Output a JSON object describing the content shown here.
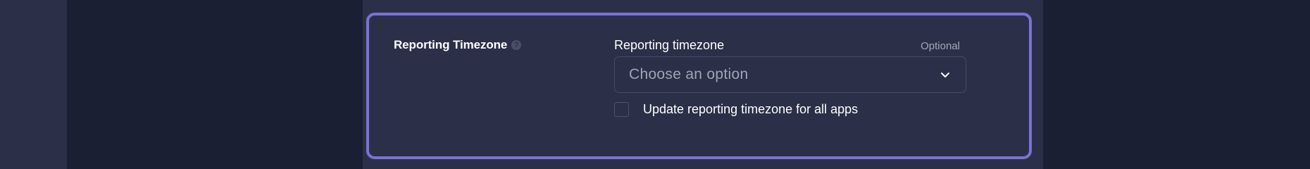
{
  "section": {
    "title": "Reporting Timezone",
    "help_icon": "question-circle-icon"
  },
  "field": {
    "label": "Reporting timezone",
    "optional_text": "Optional",
    "placeholder": "Choose an option",
    "chevron_icon": "chevron-down-icon"
  },
  "checkbox": {
    "label": "Update reporting timezone for all apps",
    "checked": false
  },
  "colors": {
    "background": "#1b1f33",
    "panel": "#2b3048",
    "focus_border": "#7b72d6",
    "text_primary": "#ffffff",
    "text_muted": "#a3a7b8"
  }
}
